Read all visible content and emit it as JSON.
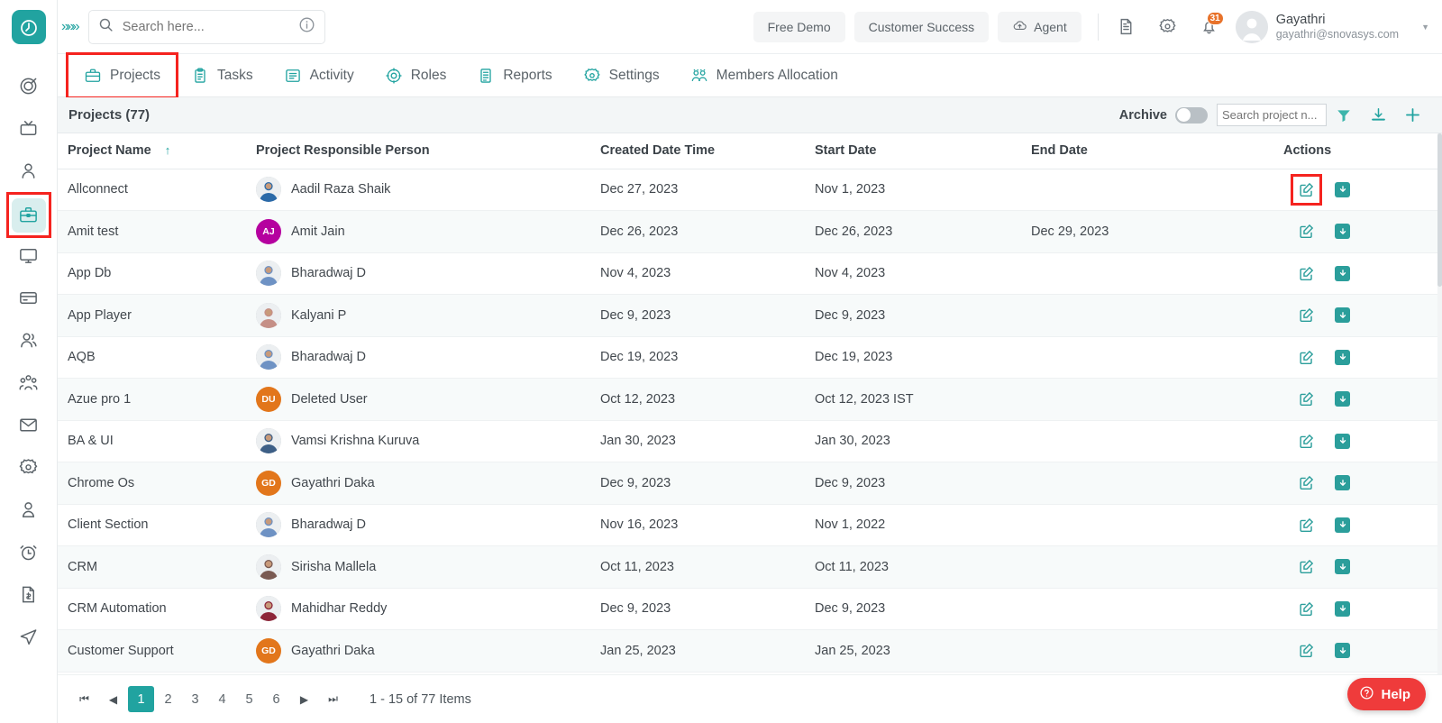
{
  "brand": {
    "accent": "#21a3a0",
    "alert": "#f5231f",
    "badge_color": "#e8722a",
    "help_color": "#ef3b3b"
  },
  "header": {
    "search_placeholder": "Search here...",
    "buttons": [
      {
        "label": "Free Demo",
        "icon": ""
      },
      {
        "label": "Customer Success",
        "icon": ""
      },
      {
        "label": "Agent",
        "icon": "cloud-upload-icon"
      }
    ],
    "icons": [
      "document-icon",
      "gear-icon",
      "bell-icon"
    ],
    "notification_count": "31",
    "user": {
      "name": "Gayathri",
      "email": "gayathri@snovasys.com"
    }
  },
  "rail": {
    "items": [
      {
        "name": "target-icon",
        "active": false
      },
      {
        "name": "tv-icon",
        "active": false
      },
      {
        "name": "person-icon",
        "active": false
      },
      {
        "name": "briefcase-icon",
        "active": true
      },
      {
        "name": "monitor-icon",
        "active": false
      },
      {
        "name": "card-icon",
        "active": false
      },
      {
        "name": "users-icon",
        "active": false
      },
      {
        "name": "team-icon",
        "active": false
      },
      {
        "name": "mail-icon",
        "active": false
      },
      {
        "name": "settings-icon",
        "active": false
      },
      {
        "name": "profile-icon",
        "active": false
      },
      {
        "name": "alarm-icon",
        "active": false
      },
      {
        "name": "invoice-icon",
        "active": false
      },
      {
        "name": "send-icon",
        "active": false
      }
    ]
  },
  "tabs": [
    {
      "label": "Projects",
      "icon": "briefcase-icon",
      "active": true
    },
    {
      "label": "Tasks",
      "icon": "clipboard-icon",
      "active": false
    },
    {
      "label": "Activity",
      "icon": "list-icon",
      "active": false
    },
    {
      "label": "Roles",
      "icon": "roles-icon",
      "active": false
    },
    {
      "label": "Reports",
      "icon": "report-icon",
      "active": false
    },
    {
      "label": "Settings",
      "icon": "gear-icon",
      "active": false
    },
    {
      "label": "Members Allocation",
      "icon": "members-icon",
      "active": false
    }
  ],
  "toolbar": {
    "title": "Projects (77)",
    "archive_label": "Archive",
    "archive_on": false,
    "search_placeholder": "Search project n...",
    "icons": [
      "filter-icon",
      "download-icon",
      "add-icon"
    ]
  },
  "table": {
    "columns": [
      "Project Name",
      "Project Responsible Person",
      "Created Date Time",
      "Start Date",
      "End Date",
      "Actions"
    ],
    "sort_column": "Project Name",
    "sort_direction": "asc",
    "rows": [
      {
        "project": "Allconnect",
        "person": "Aadil Raza Shaik",
        "avatar_type": "photo",
        "avatar_color": "#2b6aa8",
        "initials": "",
        "created": "Dec 27, 2023",
        "start": "Nov 1, 2023",
        "end": "",
        "edit_highlighted": true
      },
      {
        "project": "Amit test",
        "person": "Amit Jain",
        "avatar_type": "initials",
        "avatar_color": "#b5019f",
        "initials": "AJ",
        "created": "Dec 26, 2023",
        "start": "Dec 26, 2023",
        "end": "Dec 29, 2023",
        "edit_highlighted": false
      },
      {
        "project": "App Db",
        "person": "Bharadwaj D",
        "avatar_type": "photo",
        "avatar_color": "#6e92c4",
        "initials": "",
        "created": "Nov 4, 2023",
        "start": "Nov 4, 2023",
        "end": "",
        "edit_highlighted": false
      },
      {
        "project": "App Player",
        "person": "Kalyani P",
        "avatar_type": "photo",
        "avatar_color": "#c58f86",
        "initials": "",
        "created": "Dec 9, 2023",
        "start": "Dec 9, 2023",
        "end": "",
        "edit_highlighted": false
      },
      {
        "project": "AQB",
        "person": "Bharadwaj D",
        "avatar_type": "photo",
        "avatar_color": "#6e92c4",
        "initials": "",
        "created": "Dec 19, 2023",
        "start": "Dec 19, 2023",
        "end": "",
        "edit_highlighted": false
      },
      {
        "project": "Azue pro 1",
        "person": "Deleted User",
        "avatar_type": "initials",
        "avatar_color": "#e2761b",
        "initials": "DU",
        "created": "Oct 12, 2023",
        "start": "Oct 12, 2023 IST",
        "end": "",
        "edit_highlighted": false
      },
      {
        "project": "BA & UI",
        "person": "Vamsi Krishna Kuruva",
        "avatar_type": "photo",
        "avatar_color": "#3d5f86",
        "initials": "",
        "created": "Jan 30, 2023",
        "start": "Jan 30, 2023",
        "end": "",
        "edit_highlighted": false
      },
      {
        "project": "Chrome Os",
        "person": "Gayathri Daka",
        "avatar_type": "initials",
        "avatar_color": "#e2761b",
        "initials": "GD",
        "created": "Dec 9, 2023",
        "start": "Dec 9, 2023",
        "end": "",
        "edit_highlighted": false
      },
      {
        "project": "Client Section",
        "person": "Bharadwaj D",
        "avatar_type": "photo",
        "avatar_color": "#6e92c4",
        "initials": "",
        "created": "Nov 16, 2023",
        "start": "Nov 1, 2022",
        "end": "",
        "edit_highlighted": false
      },
      {
        "project": "CRM",
        "person": "Sirisha Mallela",
        "avatar_type": "photo",
        "avatar_color": "#7a5a52",
        "initials": "",
        "created": "Oct 11, 2023",
        "start": "Oct 11, 2023",
        "end": "",
        "edit_highlighted": false
      },
      {
        "project": "CRM Automation",
        "person": "Mahidhar Reddy",
        "avatar_type": "photo",
        "avatar_color": "#8d2639",
        "initials": "",
        "created": "Dec 9, 2023",
        "start": "Dec 9, 2023",
        "end": "",
        "edit_highlighted": false
      },
      {
        "project": "Customer Support",
        "person": "Gayathri Daka",
        "avatar_type": "initials",
        "avatar_color": "#e2761b",
        "initials": "GD",
        "created": "Jan 25, 2023",
        "start": "Jan 25, 2023",
        "end": "",
        "edit_highlighted": false
      }
    ]
  },
  "pager": {
    "pages": [
      "1",
      "2",
      "3",
      "4",
      "5",
      "6"
    ],
    "active_page": "1",
    "info": "1 - 15 of 77 Items"
  },
  "help": {
    "label": "Help",
    "icon": "question-icon"
  }
}
